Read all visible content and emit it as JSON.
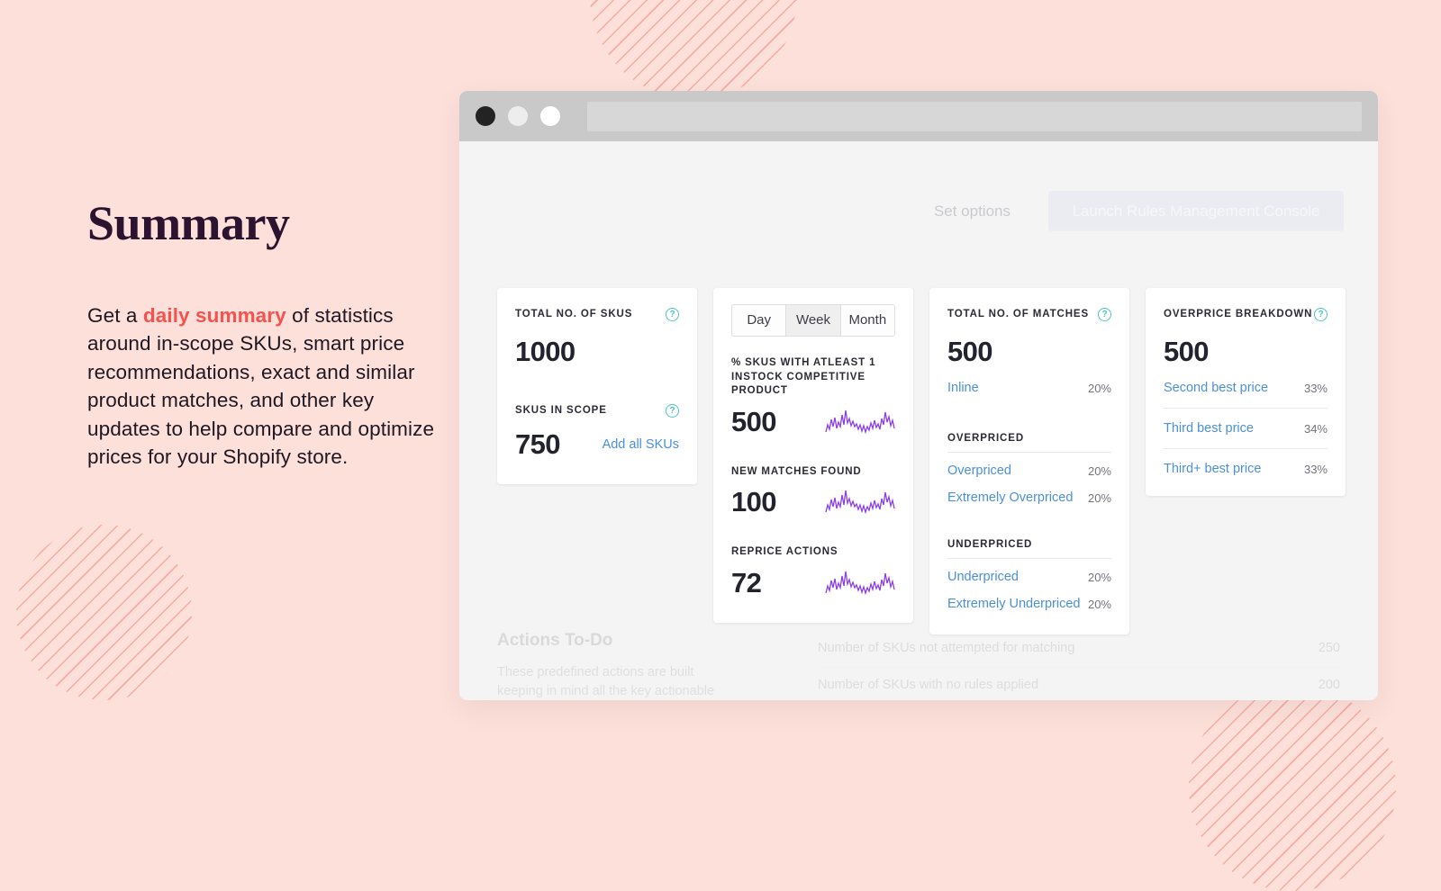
{
  "page": {
    "title": "Summary",
    "paragraph_pre": "Get a ",
    "paragraph_highlight": "daily summary",
    "paragraph_post": " of statistics around in-scope SKUs, smart price recommendations, exact and similar product matches, and other key updates to help compare and optimize prices for your Shopify store.",
    "background_color": "#fce0d9",
    "highlight_color": "#f5514f",
    "title_color": "#2c1330"
  },
  "browser": {
    "dots": [
      "close",
      "minimize",
      "maximize"
    ],
    "address_bar_value": ""
  },
  "top_actions": {
    "set_options_label": "Set options",
    "launch_console_label": "Launch Rules Management Console"
  },
  "cards": {
    "skus": {
      "label": "TOTAL NO. OF SKUS",
      "help_icon": "question-icon",
      "value": "1000",
      "secondary_label": "SKUS IN SCOPE",
      "secondary_help_icon": "question-icon",
      "secondary_value": "750",
      "action_link": "Add all SKUs"
    },
    "period": {
      "toggle": [
        {
          "label": "Day",
          "active": false
        },
        {
          "label": "Week",
          "active": true
        },
        {
          "label": "Month",
          "active": false
        }
      ],
      "stats": [
        {
          "title": "% SKUS WITH ATLEAST 1 INSTOCK COMPETITIVE PRODUCT",
          "value": "500",
          "sparkline": "sparkline-icon"
        },
        {
          "title": "NEW MATCHES FOUND",
          "value": "100",
          "sparkline": "sparkline-icon"
        },
        {
          "title": "REPRICE ACTIONS",
          "value": "72",
          "sparkline": "sparkline-icon"
        }
      ]
    },
    "matches": {
      "label": "TOTAL NO. OF MATCHES",
      "help_icon": "question-icon",
      "value": "500",
      "inline": {
        "label": "Inline",
        "pct": "20%"
      },
      "overpriced_heading": "OVERPRICED",
      "overpriced_rows": [
        {
          "label": "Overpriced",
          "pct": "20%"
        },
        {
          "label": "Extremely Overpriced",
          "pct": "20%"
        }
      ],
      "underpriced_heading": "UNDERPRICED",
      "underpriced_rows": [
        {
          "label": "Underpriced",
          "pct": "20%"
        },
        {
          "label": "Extremely Underpriced",
          "pct": "20%"
        }
      ]
    },
    "overprice": {
      "label": "OVERPRICE BREAKDOWN",
      "help_icon": "question-icon",
      "value": "500",
      "rows": [
        {
          "label": "Second best price",
          "pct": "33%"
        },
        {
          "label": "Third best price",
          "pct": "34%"
        },
        {
          "label": "Third+ best price",
          "pct": "33%"
        }
      ]
    }
  },
  "actions_todo": {
    "title": "Actions To-Do",
    "subtitle": "These predefined actions are built keeping in mind all the key actionable",
    "rows": [
      {
        "label": "Number of SKUs not attempted for matching",
        "value": "250"
      },
      {
        "label": "Number of SKUs with no rules applied",
        "value": "200"
      }
    ]
  }
}
